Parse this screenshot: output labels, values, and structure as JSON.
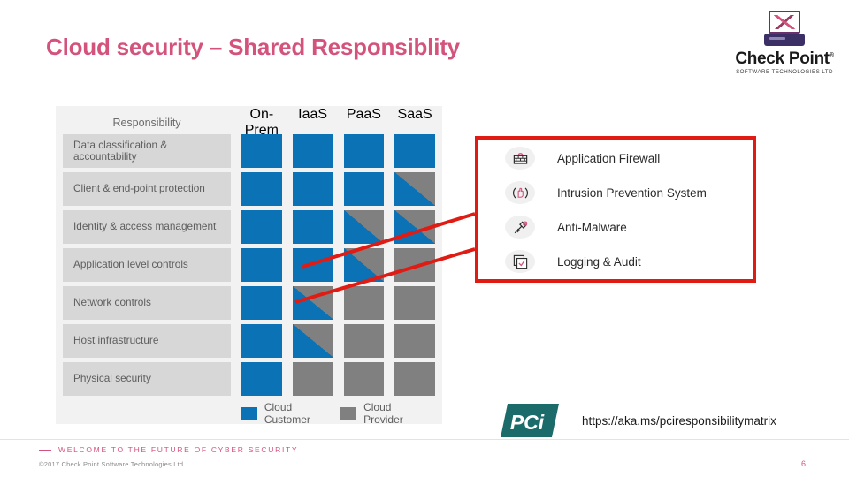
{
  "slide": {
    "title": "Cloud security – Shared Responsiblity",
    "title_color": "#d4537c",
    "page_number": "6"
  },
  "brand": {
    "name": "Check Point",
    "registered_mark": "®",
    "tagline": "SOFTWARE TECHNOLOGIES LTD",
    "logo_icon": "checkpoint-computer-icon"
  },
  "matrix": {
    "columns": [
      "Responsibility",
      "On-Prem",
      "IaaS",
      "PaaS",
      "SaaS"
    ],
    "rows": [
      {
        "label": "Data classification & accountability",
        "cells": [
          "blue",
          "blue",
          "blue",
          "blue"
        ]
      },
      {
        "label": "Client & end-point protection",
        "cells": [
          "blue",
          "blue",
          "blue",
          "diag"
        ]
      },
      {
        "label": "Identity & access management",
        "cells": [
          "blue",
          "blue",
          "diag",
          "diag"
        ]
      },
      {
        "label": "Application level controls",
        "cells": [
          "blue",
          "blue",
          "diag",
          "gray"
        ]
      },
      {
        "label": "Network controls",
        "cells": [
          "blue",
          "diag",
          "gray",
          "gray"
        ]
      },
      {
        "label": "Host infrastructure",
        "cells": [
          "blue",
          "diag",
          "gray",
          "gray"
        ]
      },
      {
        "label": "Physical security",
        "cells": [
          "blue",
          "gray",
          "gray",
          "gray"
        ]
      }
    ],
    "legend": [
      {
        "label": "Cloud Customer",
        "color": "#0b72b5"
      },
      {
        "label": "Cloud Provider",
        "color": "#808080"
      }
    ],
    "colors": {
      "customer": "#0b72b5",
      "provider": "#808080",
      "row_label_bg": "#d7d7d7",
      "panel_bg": "#f2f2f2"
    }
  },
  "callout": {
    "border_color": "#e01b13",
    "items": [
      {
        "label": "Application Firewall",
        "icon": "firewall-brick-wall-icon"
      },
      {
        "label": "Intrusion Prevention System",
        "icon": "stop-hand-shield-icon"
      },
      {
        "label": "Anti-Malware",
        "icon": "syringe-virus-icon"
      },
      {
        "label": "Logging & Audit",
        "icon": "checklist-clipboard-icon"
      }
    ]
  },
  "reference": {
    "logo_text": "PCI",
    "logo_color": "#1c6b6b",
    "url": "https://aka.ms/pciresponsibilitymatrix"
  },
  "footer": {
    "tagline": "WELCOME TO THE FUTURE OF CYBER SECURITY",
    "copyright": "©2017 Check Point Software Technologies Ltd."
  }
}
